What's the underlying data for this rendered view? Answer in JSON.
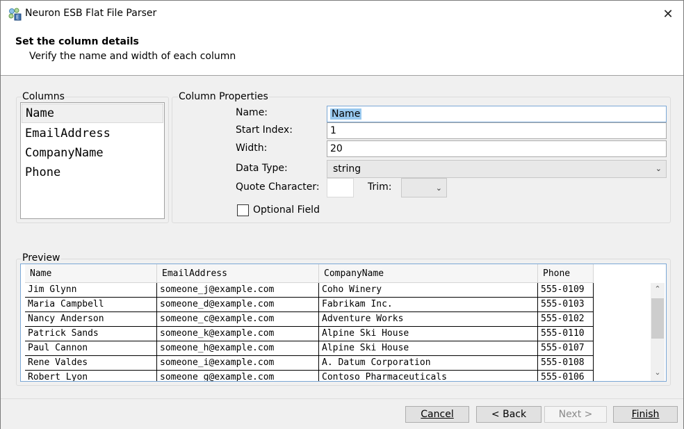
{
  "window": {
    "title": "Neuron ESB Flat File Parser"
  },
  "header": {
    "title": "Set the column details",
    "subtitle": "Verify the name and width of each column"
  },
  "columns": {
    "group_label": "Columns",
    "items": [
      "Name",
      "EmailAddress",
      "CompanyName",
      "Phone"
    ],
    "selected": "Name"
  },
  "properties": {
    "group_label": "Column Properties",
    "name_label": "Name:",
    "name_value": "Name",
    "start_index_label": "Start Index:",
    "start_index_value": "1",
    "width_label": "Width:",
    "width_value": "20",
    "data_type_label": "Data Type:",
    "data_type_value": "string",
    "quote_char_label": "Quote Character:",
    "quote_char_value": "",
    "trim_label": "Trim:",
    "trim_value": "",
    "optional_label": "Optional Field",
    "optional_checked": false
  },
  "preview": {
    "group_label": "Preview",
    "headers": [
      "Name",
      "EmailAddress",
      "CompanyName",
      "Phone"
    ],
    "rows": [
      [
        "Jim Glynn",
        "someone_j@example.com",
        "Coho Winery",
        "555-0109"
      ],
      [
        "Maria Campbell",
        "someone_d@example.com",
        "Fabrikam Inc.",
        "555-0103"
      ],
      [
        "Nancy Anderson",
        "someone_c@example.com",
        "Adventure Works",
        "555-0102"
      ],
      [
        "Patrick Sands",
        "someone_k@example.com",
        "Alpine Ski House",
        "555-0110"
      ],
      [
        "Paul Cannon",
        "someone_h@example.com",
        "Alpine Ski House",
        "555-0107"
      ],
      [
        "Rene Valdes",
        "someone_i@example.com",
        "A. Datum Corporation",
        "555-0108"
      ],
      [
        "Robert Lyon",
        "someone_g@example.com",
        "Contoso Pharmaceuticals",
        "555-0106"
      ]
    ]
  },
  "buttons": {
    "cancel": "Cancel",
    "back": "< Back",
    "next": "Next >",
    "finish": "Finish"
  },
  "colors": {
    "selection": "#99c9ef",
    "focus_border": "#7aa7d6"
  }
}
